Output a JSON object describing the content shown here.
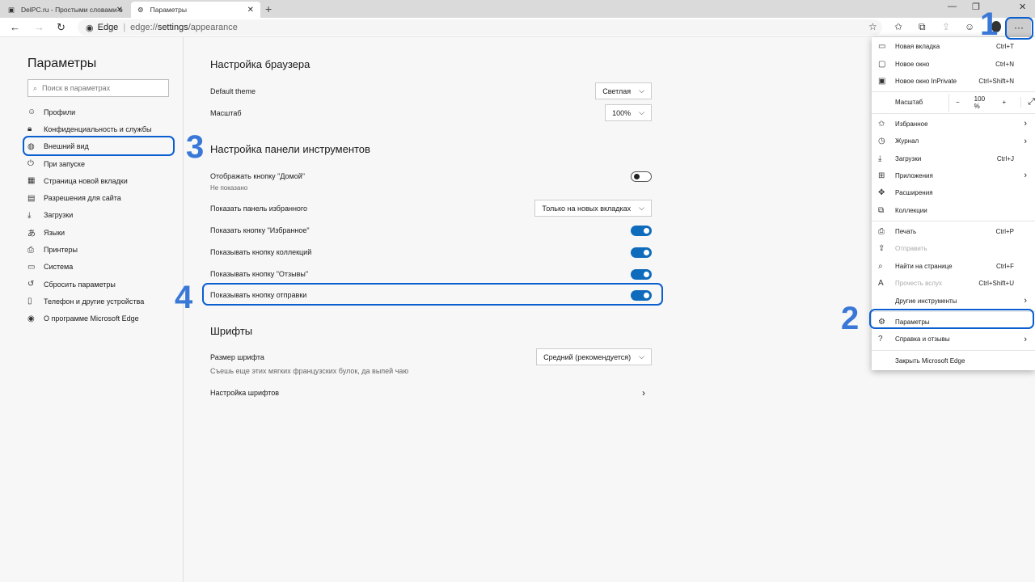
{
  "tabs": [
    {
      "label": "DelPC.ru - Простыми словами о",
      "icon": "page-icon"
    },
    {
      "label": "Параметры",
      "icon": "gear-icon"
    }
  ],
  "address": {
    "site_label": "Edge",
    "url_prefix": "edge://",
    "url_bold": "settings",
    "url_suffix": "/appearance"
  },
  "sidebar": {
    "title": "Параметры",
    "search_placeholder": "Поиск в параметрах",
    "items": [
      {
        "label": "Профили",
        "icon": "profile-icon"
      },
      {
        "label": "Конфиденциальность и службы",
        "icon": "lock-icon"
      },
      {
        "label": "Внешний вид",
        "icon": "palette-icon",
        "active": true
      },
      {
        "label": "При запуске",
        "icon": "power-icon"
      },
      {
        "label": "Страница новой вкладки",
        "icon": "grid-icon"
      },
      {
        "label": "Разрешения для сайта",
        "icon": "site-permissions-icon"
      },
      {
        "label": "Загрузки",
        "icon": "download-icon"
      },
      {
        "label": "Языки",
        "icon": "language-icon"
      },
      {
        "label": "Принтеры",
        "icon": "printer-icon"
      },
      {
        "label": "Система",
        "icon": "system-icon"
      },
      {
        "label": "Сбросить параметры",
        "icon": "reset-icon"
      },
      {
        "label": "Телефон и другие устройства",
        "icon": "phone-icon"
      },
      {
        "label": "О программе Microsoft Edge",
        "icon": "edge-icon"
      }
    ]
  },
  "main": {
    "browser": {
      "title": "Настройка браузера",
      "theme_label": "Default theme",
      "theme_value": "Светлая",
      "zoom_label": "Масштаб",
      "zoom_value": "100%"
    },
    "toolbar": {
      "title": "Настройка панели инструментов",
      "home_label": "Отображать кнопку \"Домой\"",
      "home_sub": "Не показано",
      "home_on": false,
      "fav_bar_label": "Показать панель избранного",
      "fav_bar_value": "Только на новых вкладках",
      "fav_label": "Показать кнопку \"Избранное\"",
      "fav_on": true,
      "coll_label": "Показывать кнопку коллекций",
      "coll_on": true,
      "feedback_label": "Показывать кнопку \"Отзывы\"",
      "feedback_on": true,
      "share_label": "Показывать кнопку отправки",
      "share_on": true
    },
    "fonts": {
      "title": "Шрифты",
      "size_label": "Размер шрифта",
      "size_value": "Средний (рекомендуется)",
      "sample": "Съешь еще этих мягких французских булок, да выпей чаю",
      "custom_label": "Настройка шрифтов"
    }
  },
  "menu": {
    "items": [
      {
        "label": "Новая вкладка",
        "shortcut": "Ctrl+T",
        "icon": "new-tab-icon"
      },
      {
        "label": "Новое окно",
        "shortcut": "Ctrl+N",
        "icon": "window-icon"
      },
      {
        "label": "Новое окно InPrivate",
        "shortcut": "Ctrl+Shift+N",
        "icon": "inprivate-icon",
        "sep": true
      },
      {
        "label": "Масштаб",
        "zoom": "100 %",
        "sep": true
      },
      {
        "label": "Избранное",
        "icon": "favorites-icon",
        "arrow": true
      },
      {
        "label": "Журнал",
        "icon": "history-icon",
        "arrow": true
      },
      {
        "label": "Загрузки",
        "shortcut": "Ctrl+J",
        "icon": "download-icon"
      },
      {
        "label": "Приложения",
        "icon": "apps-icon",
        "arrow": true
      },
      {
        "label": "Расширения",
        "icon": "extensions-icon"
      },
      {
        "label": "Коллекции",
        "icon": "collections-icon",
        "sep": true
      },
      {
        "label": "Печать",
        "shortcut": "Ctrl+P",
        "icon": "print-icon"
      },
      {
        "label": "Отправить",
        "icon": "share-icon",
        "disabled": true
      },
      {
        "label": "Найти на странице",
        "shortcut": "Ctrl+F",
        "icon": "find-icon"
      },
      {
        "label": "Прочесть вслух",
        "shortcut": "Ctrl+Shift+U",
        "icon": "read-aloud-icon",
        "disabled": true
      },
      {
        "label": "Другие инструменты",
        "arrow": true,
        "sep": true
      },
      {
        "label": "Параметры",
        "icon": "gear-icon"
      },
      {
        "label": "Справка и отзывы",
        "icon": "help-icon",
        "arrow": true,
        "sep": true
      },
      {
        "label": "Закрыть Microsoft Edge"
      }
    ]
  },
  "annotations": [
    "1",
    "2",
    "3",
    "4"
  ],
  "accent": "#0f6cbd",
  "annotation_color": "#3a78d8"
}
